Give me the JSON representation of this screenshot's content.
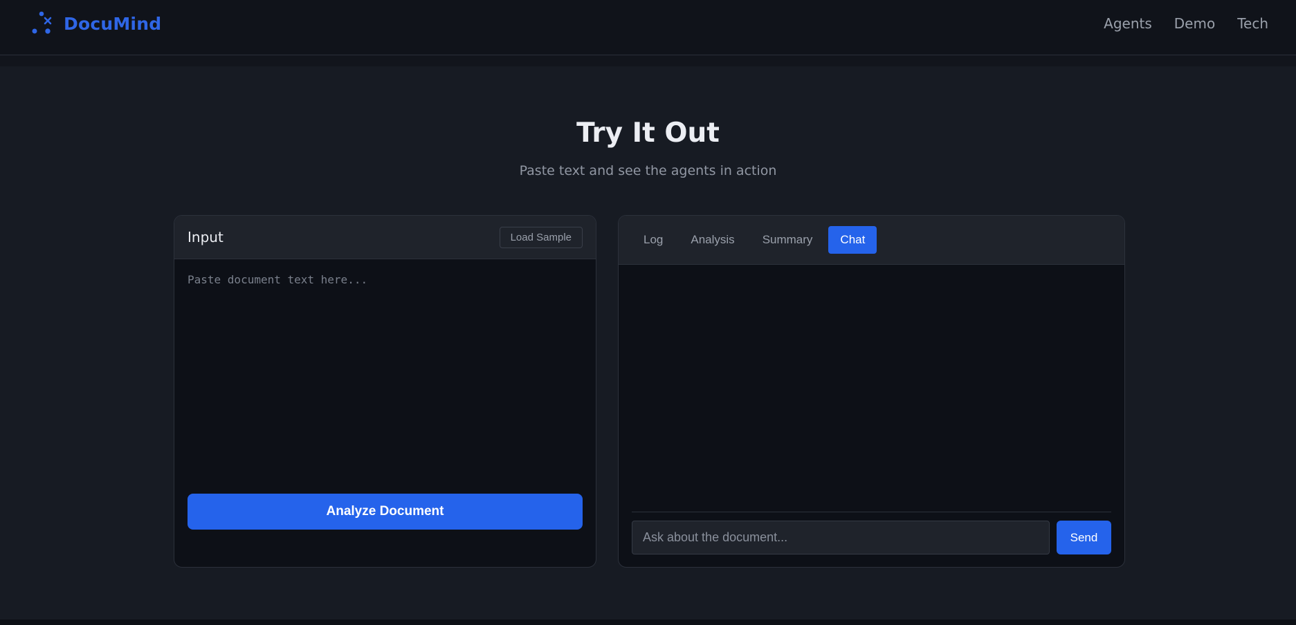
{
  "header": {
    "brand": "DocuMind",
    "brand_color": "#2f66e6",
    "nav": [
      {
        "label": "Agents"
      },
      {
        "label": "Demo"
      },
      {
        "label": "Tech"
      }
    ]
  },
  "hero": {
    "title": "Try It Out",
    "subtitle": "Paste text and see the agents in action"
  },
  "input_panel": {
    "label": "Input",
    "load_sample_label": "Load Sample",
    "textarea_placeholder": "Paste document text here...",
    "textarea_value": "",
    "analyze_label": "Analyze Document"
  },
  "output_panel": {
    "tabs": [
      {
        "label": "Log",
        "active": false
      },
      {
        "label": "Analysis",
        "active": false
      },
      {
        "label": "Summary",
        "active": false
      },
      {
        "label": "Chat",
        "active": true
      }
    ],
    "chat_placeholder": "Ask about the document...",
    "chat_value": "",
    "send_label": "Send"
  },
  "colors": {
    "accent": "#2563eb",
    "background": "#171b23",
    "panel": "#0d1017"
  }
}
